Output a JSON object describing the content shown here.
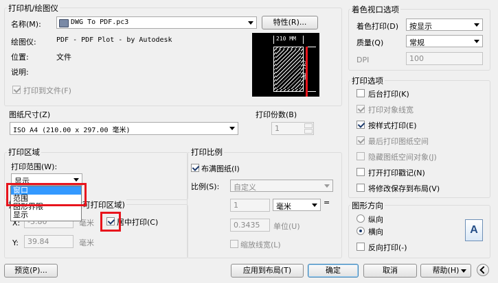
{
  "printer": {
    "title": "打印机/绘图仪",
    "name_label": "名称(M):",
    "name_value": "DWG To PDF.pc3",
    "properties_button": "特性(R)...",
    "plotter_label": "绘图仪:",
    "plotter_value": "PDF - PDF Plot - by Autodesk",
    "location_label": "位置:",
    "location_value": "文件",
    "description_label": "说明:",
    "print_to_file_label": "打印到文件(F)",
    "preview_width": "210 MM",
    "preview_height": "297 MM"
  },
  "paper_size": {
    "title": "图纸尺寸(Z)",
    "value": "ISO A4 (210.00 x 297.00 毫米)"
  },
  "copies": {
    "title": "打印份数(B)",
    "value": "1"
  },
  "plot_area": {
    "title": "打印区域",
    "range_label": "打印范围(W):",
    "range_value": "显示",
    "dropdown_options": [
      "窗口",
      "范围",
      "图形界限",
      "显示"
    ]
  },
  "plot_offset": {
    "title": "打印偏移(原点设置在可打印区域)",
    "x_label": "X:",
    "x_value": "-3.80",
    "y_label": "Y:",
    "y_value": "39.84",
    "unit_x": "毫米",
    "unit_y": "毫米",
    "center_label": "居中打印(C)"
  },
  "plot_scale": {
    "title": "打印比例",
    "fit_label": "布满图纸(I)",
    "scale_label": "比例(S):",
    "scale_value": "自定义",
    "value1": "1",
    "unit_value": "毫米",
    "equals": "=",
    "value2": "0.3435",
    "unit_label": "单位(U)",
    "lineweight_label": "缩放线宽(L)"
  },
  "shaded": {
    "title": "着色视口选项",
    "shade_label": "着色打印(D)",
    "shade_value": "按显示",
    "quality_label": "质量(Q)",
    "quality_value": "常规",
    "dpi_label": "DPI",
    "dpi_value": "100"
  },
  "plot_options": {
    "title": "打印选项",
    "items": [
      {
        "label": "后台打印(K)"
      },
      {
        "label": "打印对象线宽"
      },
      {
        "label": "按样式打印(E)"
      },
      {
        "label": "最后打印图纸空间"
      },
      {
        "label": "隐藏图纸空间对象(J)"
      },
      {
        "label": "打开打印戳记(N)"
      },
      {
        "label": "将修改保存到布局(V)"
      }
    ]
  },
  "orientation": {
    "title": "图形方向",
    "portrait": "纵向",
    "landscape": "横向",
    "reverse": "反向打印(-)",
    "letter": "A"
  },
  "footer": {
    "preview": "预览(P)...",
    "apply": "应用到布局(T)",
    "ok": "确定",
    "cancel": "取消",
    "help": "帮助(H)"
  },
  "colors": {
    "highlight": "#3399ff",
    "annotation_red": "#e8141c"
  }
}
